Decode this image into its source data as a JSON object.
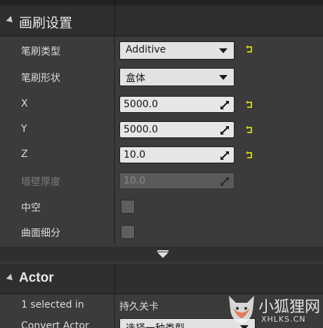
{
  "brush_section": {
    "title": "画刷设置",
    "rows": {
      "brush_type": {
        "label": "笔刷类型",
        "value": "Additive"
      },
      "brush_shape": {
        "label": "笔刷形状",
        "value": "盒体"
      },
      "x": {
        "label": "X",
        "value": "5000.0"
      },
      "y": {
        "label": "Y",
        "value": "5000.0"
      },
      "z": {
        "label": "Z",
        "value": "10.0"
      },
      "wall_thickness": {
        "label": "墙壁厚度",
        "value": "10.0"
      },
      "hollow": {
        "label": "中空",
        "checked": false
      },
      "tessellated": {
        "label": "曲面细分",
        "checked": false
      }
    }
  },
  "actor_section": {
    "title": "Actor",
    "selected_label": "1 selected in",
    "selected_value": "持久关卡",
    "convert_label": "Convert Actor",
    "convert_value": "选择一种类型"
  },
  "watermark": {
    "text": "小狐狸网",
    "sub": "XHLKS.CN"
  },
  "colors": {
    "reset_arrow": "#c8c820",
    "panel_bg": "#3b3b3b",
    "header_bg": "#2e2e2e"
  },
  "icons": {
    "section_expand": "expanded-arrow-icon",
    "combo_caret": "chevron-down-icon",
    "drag": "drag-resize-icon",
    "reset": "reset-to-default-icon",
    "advanced": "show-advanced-icon",
    "logo": "fox-logo"
  }
}
